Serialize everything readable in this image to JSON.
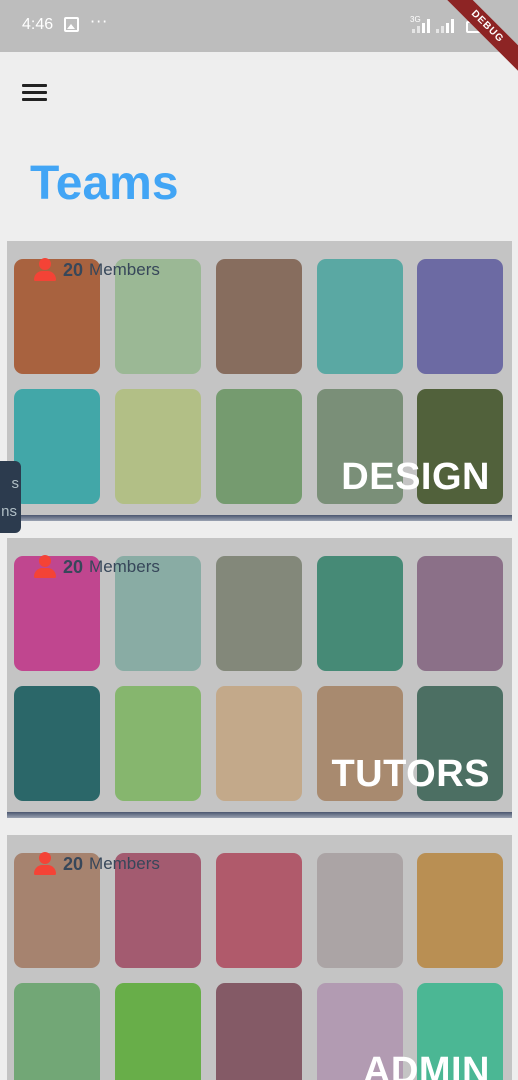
{
  "status_bar": {
    "time": "4:46",
    "overflow": "···",
    "network": "3G",
    "debug_banner": "DEBUG",
    "icons": [
      "image-notification-icon",
      "signal-icon",
      "battery-charging-icon"
    ]
  },
  "app_bar": {
    "menu_icon": "hamburger-menu-icon"
  },
  "page": {
    "title": "Teams"
  },
  "side_tab": {
    "line1": "s",
    "line2": "ns"
  },
  "teams": [
    {
      "name": "DESIGN",
      "member_count": "20",
      "member_label": "Members",
      "tile_colors": [
        "#a8623f",
        "#9bb895",
        "#876d5e",
        "#5aa8a3",
        "#6c6aa3",
        "#42a7a8",
        "#b2bf86",
        "#759b6f",
        "#7a8f78",
        "#51613b"
      ]
    },
    {
      "name": "TUTORS",
      "member_count": "20",
      "member_label": "Members",
      "tile_colors": [
        "#c0468f",
        "#89aca4",
        "#83887a",
        "#468a76",
        "#8b7088",
        "#2b6769",
        "#86b66e",
        "#c3a98a",
        "#a88a6f",
        "#4c6f63"
      ]
    },
    {
      "name": "ADMIN",
      "member_count": "20",
      "member_label": "Members",
      "tile_colors": [
        "#a6836f",
        "#a35b70",
        "#b05a6b",
        "#aba4a5",
        "#b98f53",
        "#72a776",
        "#68ae49",
        "#845a66",
        "#b29bb2",
        "#4bb794"
      ]
    }
  ]
}
